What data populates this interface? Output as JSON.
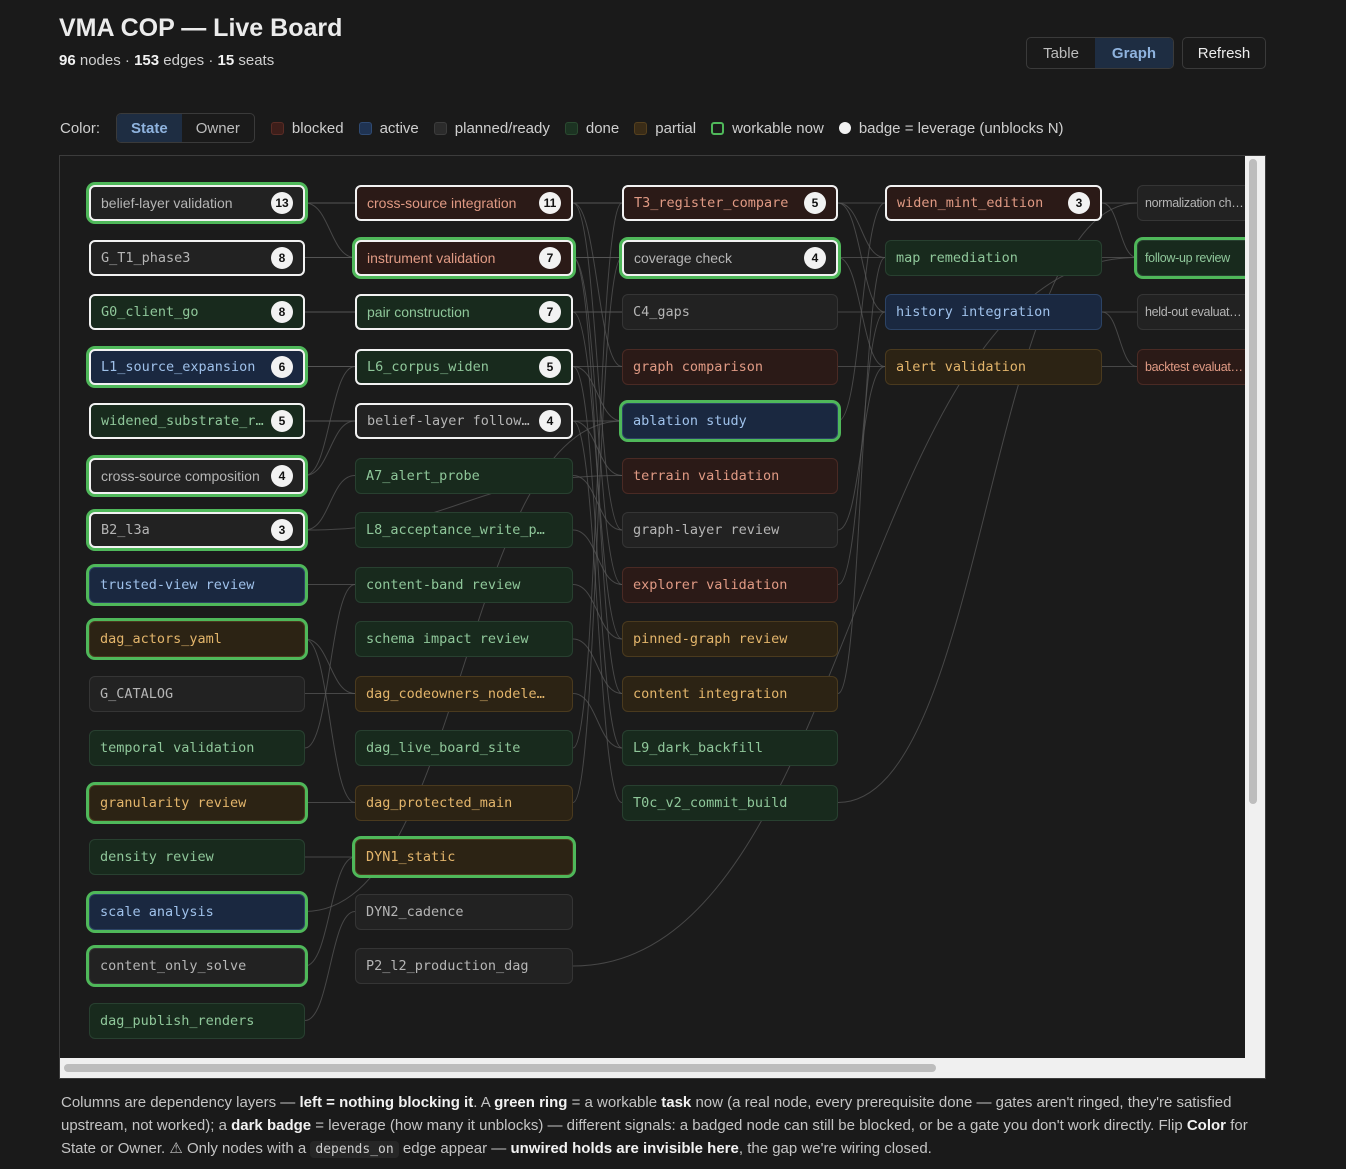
{
  "header": {
    "title": "VMA COP — Live Board",
    "nodes_count": "96",
    "nodes_label": "nodes",
    "edges_count": "153",
    "edges_label": "edges",
    "seats_count": "15",
    "seats_label": "seats",
    "sep": "·"
  },
  "toolbar": {
    "table_label": "Table",
    "graph_label": "Graph",
    "refresh_label": "Refresh",
    "selected_view": "Graph"
  },
  "legend": {
    "color_label": "Color:",
    "state_label": "State",
    "owner_label": "Owner",
    "selected_mode": "State",
    "items": [
      {
        "key": "blocked",
        "label": "blocked"
      },
      {
        "key": "active",
        "label": "active"
      },
      {
        "key": "planned",
        "label": "planned/ready"
      },
      {
        "key": "done",
        "label": "done"
      },
      {
        "key": "partial",
        "label": "partial"
      },
      {
        "key": "workable",
        "label": "workable now"
      }
    ],
    "badge_label": "badge = leverage (unblocks N)"
  },
  "colors": {
    "blocked": "#2b1a17",
    "active": "#1a2840",
    "planned": "#222222",
    "done": "#182a1d",
    "partial": "#2c2314",
    "workable_ring": "#4fb85a",
    "accent": "#8fb3de"
  },
  "graph": {
    "nodes": [
      {
        "id": "n1",
        "name": "belief-layer validation",
        "state": "planned",
        "ring": true,
        "badge": "13"
      },
      {
        "id": "n2",
        "name": "G_T1_phase3",
        "state": "planned",
        "ring": false,
        "badge": "8"
      },
      {
        "id": "n3",
        "name": "G0_client_go",
        "state": "done",
        "ring": false,
        "badge": "8"
      },
      {
        "id": "n4",
        "name": "L1_source_expansion",
        "state": "active",
        "ring": true,
        "badge": "6"
      },
      {
        "id": "n5",
        "name": "widened_substrate_rea…",
        "state": "done",
        "ring": false,
        "badge": "5"
      },
      {
        "id": "n6",
        "name": "cross-source composition",
        "state": "planned",
        "ring": true,
        "badge": "4"
      },
      {
        "id": "n7",
        "name": "B2_l3a",
        "state": "planned",
        "ring": true,
        "badge": "3"
      },
      {
        "id": "n8",
        "name": "trusted-view review",
        "state": "active",
        "ring": true,
        "badge": ""
      },
      {
        "id": "n9",
        "name": "dag_actors_yaml",
        "state": "partial",
        "ring": true,
        "badge": ""
      },
      {
        "id": "n10",
        "name": "G_CATALOG",
        "state": "planned",
        "ring": false,
        "badge": ""
      },
      {
        "id": "n11",
        "name": "temporal validation",
        "state": "done",
        "ring": false,
        "badge": ""
      },
      {
        "id": "n12",
        "name": "granularity review",
        "state": "partial",
        "ring": true,
        "badge": ""
      },
      {
        "id": "n13",
        "name": "density review",
        "state": "done",
        "ring": false,
        "badge": ""
      },
      {
        "id": "n14",
        "name": "scale analysis",
        "state": "active",
        "ring": true,
        "badge": ""
      },
      {
        "id": "n15",
        "name": "content_only_solve",
        "state": "planned",
        "ring": true,
        "badge": ""
      },
      {
        "id": "n16",
        "name": "dag_publish_renders",
        "state": "done",
        "ring": false,
        "badge": ""
      },
      {
        "id": "n17",
        "name": "cross-source integration",
        "state": "blocked",
        "ring": false,
        "badge": "11"
      },
      {
        "id": "n18",
        "name": "instrument validation",
        "state": "blocked",
        "ring": true,
        "badge": "7"
      },
      {
        "id": "n19",
        "name": "pair construction",
        "state": "done",
        "ring": false,
        "badge": "7"
      },
      {
        "id": "n20",
        "name": "L6_corpus_widen",
        "state": "done",
        "ring": false,
        "badge": "5"
      },
      {
        "id": "n21",
        "name": "belief-layer follow-up",
        "state": "planned",
        "ring": false,
        "badge": "4"
      },
      {
        "id": "n22",
        "name": "A7_alert_probe",
        "state": "done",
        "ring": false,
        "badge": ""
      },
      {
        "id": "n23",
        "name": "L8_acceptance_write_p…",
        "state": "done",
        "ring": false,
        "badge": ""
      },
      {
        "id": "n24",
        "name": "content-band review",
        "state": "done",
        "ring": false,
        "badge": ""
      },
      {
        "id": "n25",
        "name": "schema impact review",
        "state": "done",
        "ring": false,
        "badge": ""
      },
      {
        "id": "n26",
        "name": "dag_codeowners_nodele…",
        "state": "partial",
        "ring": false,
        "badge": ""
      },
      {
        "id": "n27",
        "name": "dag_live_board_site",
        "state": "done",
        "ring": false,
        "badge": ""
      },
      {
        "id": "n28",
        "name": "dag_protected_main",
        "state": "partial",
        "ring": false,
        "badge": ""
      },
      {
        "id": "n29",
        "name": "DYN1_static",
        "state": "partial",
        "ring": true,
        "badge": ""
      },
      {
        "id": "n30",
        "name": "DYN2_cadence",
        "state": "planned",
        "ring": false,
        "badge": ""
      },
      {
        "id": "n31",
        "name": "P2_l2_production_dag",
        "state": "planned",
        "ring": false,
        "badge": ""
      },
      {
        "id": "n32",
        "name": "T3_register_compare",
        "state": "blocked",
        "ring": false,
        "badge": "5"
      },
      {
        "id": "n33",
        "name": "coverage check",
        "state": "planned",
        "ring": true,
        "badge": "4"
      },
      {
        "id": "n34",
        "name": "C4_gaps",
        "state": "planned",
        "ring": false,
        "badge": ""
      },
      {
        "id": "n35",
        "name": "graph comparison",
        "state": "blocked",
        "ring": false,
        "badge": ""
      },
      {
        "id": "n36",
        "name": "ablation study",
        "state": "active",
        "ring": true,
        "badge": ""
      },
      {
        "id": "n37",
        "name": "terrain validation",
        "state": "blocked",
        "ring": false,
        "badge": ""
      },
      {
        "id": "n38",
        "name": "graph-layer review",
        "state": "planned",
        "ring": false,
        "badge": ""
      },
      {
        "id": "n39",
        "name": "explorer validation",
        "state": "blocked",
        "ring": false,
        "badge": ""
      },
      {
        "id": "n40",
        "name": "pinned-graph review",
        "state": "partial",
        "ring": false,
        "badge": ""
      },
      {
        "id": "n41",
        "name": "content integration",
        "state": "partial",
        "ring": false,
        "badge": ""
      },
      {
        "id": "n42",
        "name": "L9_dark_backfill",
        "state": "done",
        "ring": false,
        "badge": ""
      },
      {
        "id": "n43",
        "name": "T0c_v2_commit_build",
        "state": "done",
        "ring": false,
        "badge": ""
      },
      {
        "id": "n44",
        "name": "widen_mint_edition",
        "state": "blocked",
        "ring": false,
        "badge": "3"
      },
      {
        "id": "n45",
        "name": "map remediation",
        "state": "done",
        "ring": false,
        "badge": ""
      },
      {
        "id": "n46",
        "name": "history integration",
        "state": "active",
        "ring": false,
        "badge": ""
      },
      {
        "id": "n47",
        "name": "alert validation",
        "state": "partial",
        "ring": false,
        "badge": ""
      },
      {
        "id": "n48",
        "name": "normalization check",
        "state": "planned",
        "ring": false,
        "badge": ""
      },
      {
        "id": "n49",
        "name": "follow-up review",
        "state": "done",
        "ring": true,
        "badge": ""
      },
      {
        "id": "n50",
        "name": "held-out evaluation",
        "state": "planned",
        "ring": false,
        "badge": ""
      },
      {
        "id": "n51",
        "name": "backtest evaluation",
        "state": "blocked",
        "ring": false,
        "badge": ""
      }
    ],
    "edges": [
      [
        "n1",
        "n17"
      ],
      [
        "n1",
        "n32"
      ],
      [
        "n1",
        "n18"
      ],
      [
        "n2",
        "n18"
      ],
      [
        "n2",
        "n33"
      ],
      [
        "n3",
        "n19"
      ],
      [
        "n3",
        "n34"
      ],
      [
        "n4",
        "n20"
      ],
      [
        "n4",
        "n35"
      ],
      [
        "n5",
        "n21"
      ],
      [
        "n5",
        "n36"
      ],
      [
        "n6",
        "n21"
      ],
      [
        "n7",
        "n22"
      ],
      [
        "n7",
        "n37"
      ],
      [
        "n9",
        "n26"
      ],
      [
        "n9",
        "n28"
      ],
      [
        "n10",
        "n26"
      ],
      [
        "n11",
        "n24"
      ],
      [
        "n12",
        "n28"
      ],
      [
        "n13",
        "n29"
      ],
      [
        "n15",
        "n29"
      ],
      [
        "n16",
        "n30"
      ],
      [
        "n17",
        "n32"
      ],
      [
        "n17",
        "n35"
      ],
      [
        "n17",
        "n38"
      ],
      [
        "n18",
        "n33"
      ],
      [
        "n18",
        "n39"
      ],
      [
        "n18",
        "n41"
      ],
      [
        "n19",
        "n34"
      ],
      [
        "n19",
        "n40"
      ],
      [
        "n20",
        "n36"
      ],
      [
        "n20",
        "n42"
      ],
      [
        "n21",
        "n37"
      ],
      [
        "n21",
        "n43"
      ],
      [
        "n22",
        "n38"
      ],
      [
        "n23",
        "n39"
      ],
      [
        "n24",
        "n40"
      ],
      [
        "n25",
        "n41"
      ],
      [
        "n26",
        "n42"
      ],
      [
        "n32",
        "n44"
      ],
      [
        "n32",
        "n45"
      ],
      [
        "n32",
        "n46"
      ],
      [
        "n33",
        "n45"
      ],
      [
        "n33",
        "n47"
      ],
      [
        "n34",
        "n46"
      ],
      [
        "n35",
        "n47"
      ],
      [
        "n36",
        "n44"
      ],
      [
        "n44",
        "n48"
      ],
      [
        "n44",
        "n49"
      ],
      [
        "n45",
        "n49"
      ],
      [
        "n46",
        "n50"
      ],
      [
        "n47",
        "n51"
      ],
      [
        "n46",
        "n51"
      ],
      [
        "n38",
        "n47"
      ],
      [
        "n39",
        "n46"
      ],
      [
        "n41",
        "n45"
      ],
      [
        "n31",
        "n49"
      ],
      [
        "n43",
        "n48"
      ],
      [
        "n28",
        "n33"
      ],
      [
        "n27",
        "n32"
      ],
      [
        "n14",
        "n36"
      ],
      [
        "n8",
        "n24"
      ],
      [
        "n6",
        "n20"
      ]
    ]
  },
  "footer": {
    "t1": "Columns are dependency layers —",
    "b1": "left = nothing blocking it",
    "t2": ". A",
    "b2": "green ring",
    "t3": "= a workable",
    "b3": "task",
    "t4": "now (a real node, every prerequisite done — gates aren't ringed, they're satisfied upstream, not worked); a",
    "b4": "dark badge",
    "t5": "= leverage (how many it unblocks) — different signals: a badged node can still be blocked, or be a gate you don't work directly. Flip",
    "b5": "Color",
    "t6": "for State or Owner. ⚠ Only nodes with a",
    "code1": "depends_on",
    "t7": "edge appear —",
    "b6": "unwired holds are invisible here",
    "t8": ", the gap we're wiring closed."
  }
}
